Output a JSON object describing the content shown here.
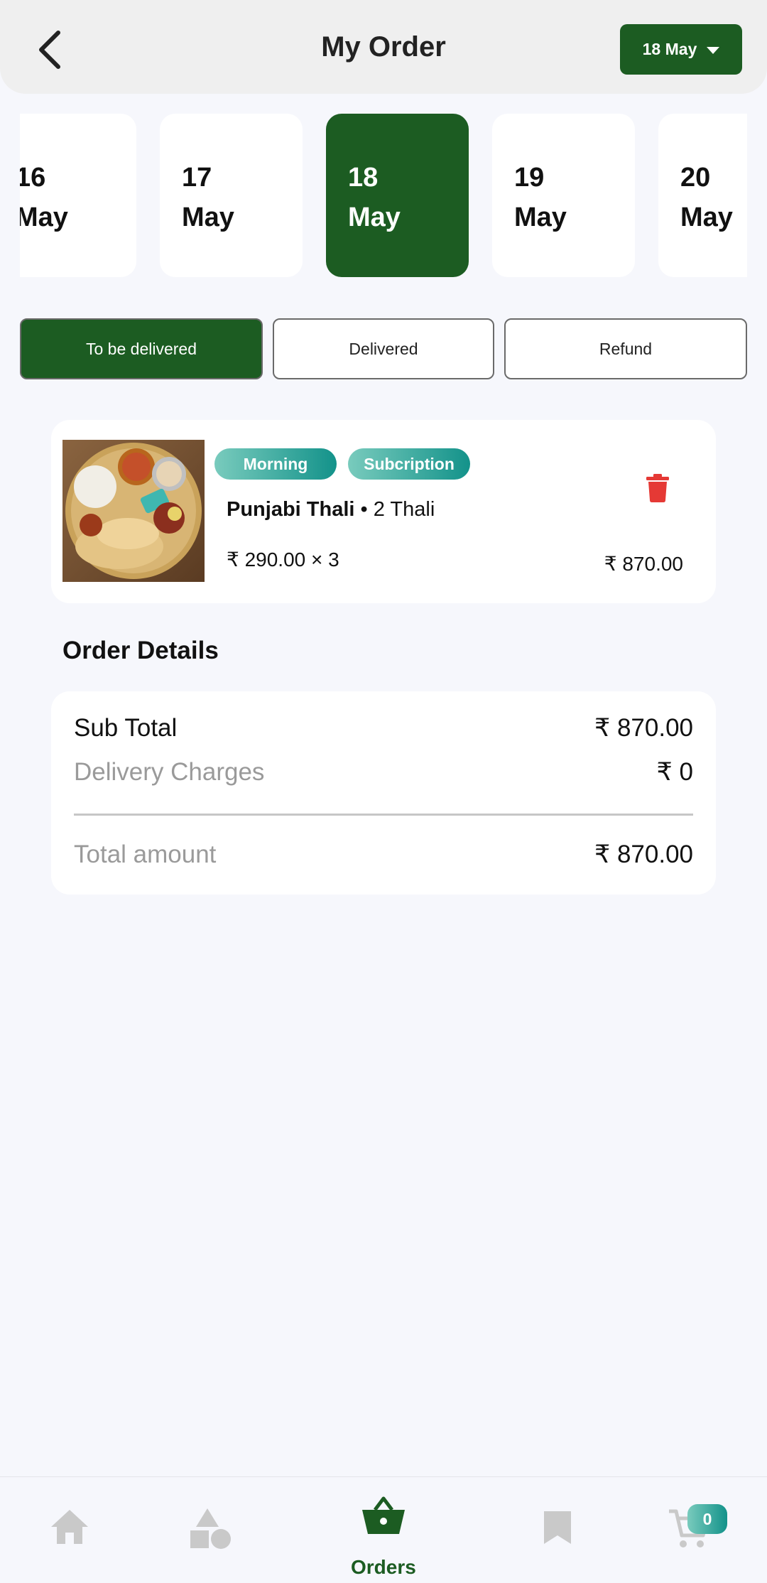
{
  "header": {
    "title": "My Order",
    "selected_date": "18 May"
  },
  "date_strip": [
    {
      "day": "16",
      "month": "May"
    },
    {
      "day": "17",
      "month": "May"
    },
    {
      "day": "18",
      "month": "May",
      "active": true
    },
    {
      "day": "19",
      "month": "May"
    },
    {
      "day": "20",
      "month": "May"
    }
  ],
  "tabs": {
    "to_be_delivered": "To be delivered",
    "delivered": "Delivered",
    "refund": "Refund",
    "active": "to_be_delivered"
  },
  "order_item": {
    "image_icon": "food-thali-photo",
    "tags": [
      "Morning",
      "Subcription"
    ],
    "name": "Punjabi Thali",
    "separator": " • ",
    "quantity_label": "2 Thali",
    "unit_price": "₹ 290.00 × 3",
    "total": "₹ 870.00",
    "delete_icon": "trash-icon"
  },
  "order_details": {
    "title": "Order Details",
    "sub_total_label": "Sub Total",
    "sub_total_value": "₹ 870.00",
    "delivery_label": "Delivery Charges",
    "delivery_value": "₹ 0",
    "total_label": "Total amount",
    "total_value": "₹ 870.00"
  },
  "bottom_nav": {
    "items": [
      "home-icon",
      "categories-icon",
      "orders-basket-icon",
      "bookmark-icon",
      "cart-icon"
    ],
    "active_label": "Orders",
    "cart_count": "0"
  },
  "colors": {
    "brand_green": "#1c5c22",
    "tag_gradient_start": "#79cbbd",
    "tag_gradient_end": "#13928a",
    "delete_red": "#e53935"
  }
}
